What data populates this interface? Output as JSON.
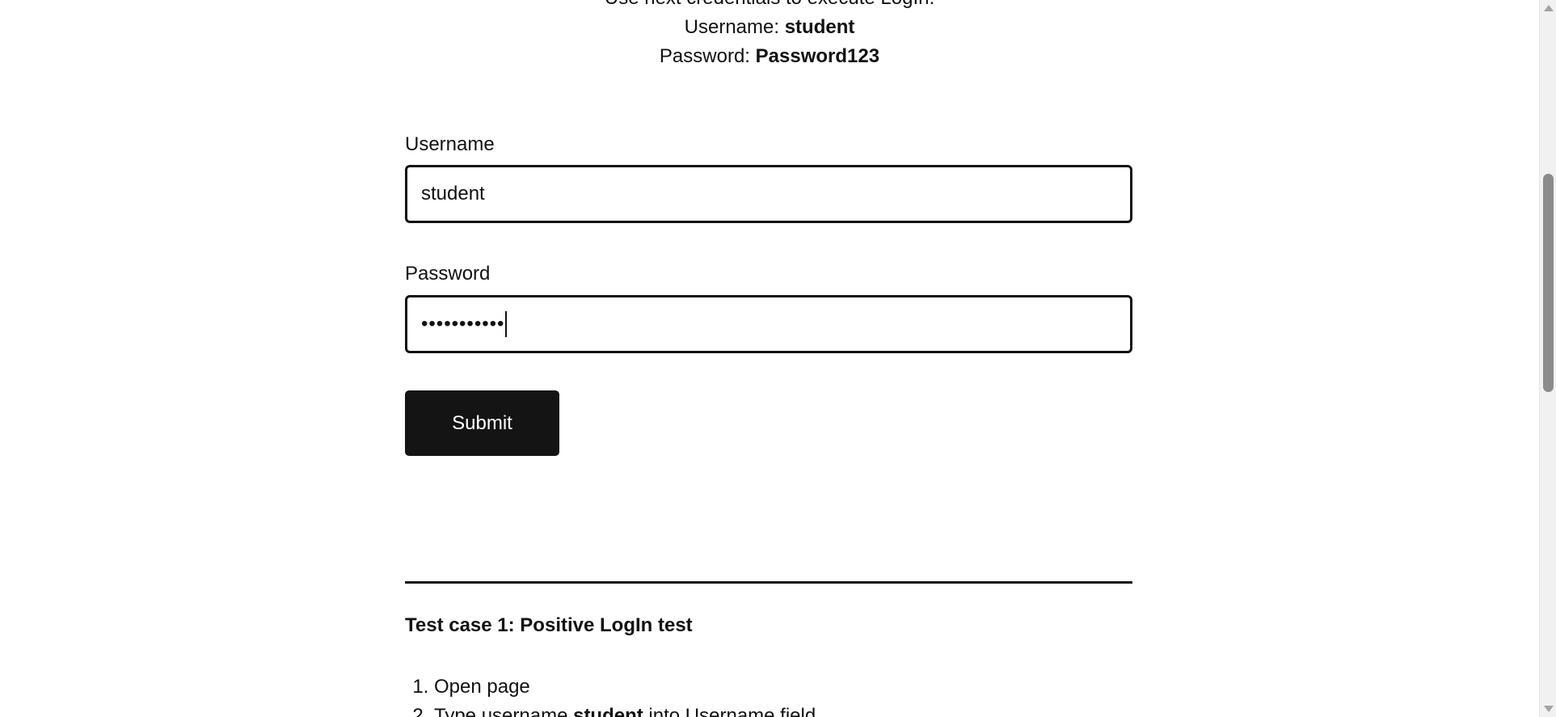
{
  "instructions": {
    "intro": "Use next credentials to execute LogIn:",
    "username_prefix": "Username:",
    "username_value": "student",
    "password_prefix": "Password:",
    "password_value": "Password123"
  },
  "form": {
    "username_label": "Username",
    "username_value": "student",
    "password_label": "Password",
    "password_masked": "•••••••••••",
    "submit_label": "Submit"
  },
  "test_case": {
    "title": "Test case 1: Positive LogIn test",
    "steps": [
      {
        "text": "Open page"
      },
      {
        "prefix": "Type username ",
        "bold": "student",
        "suffix": " into Username field"
      }
    ]
  }
}
